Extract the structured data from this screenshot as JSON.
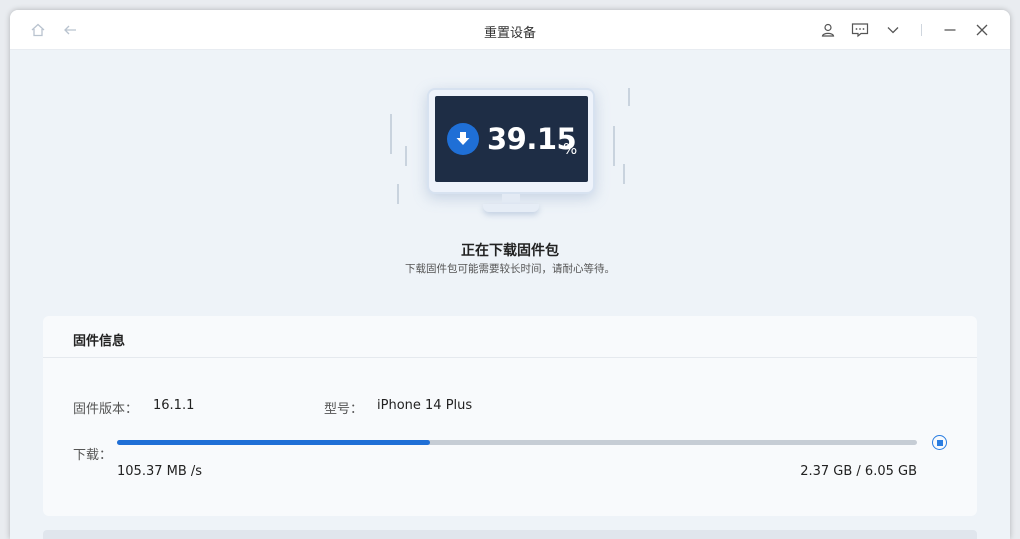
{
  "window": {
    "title": "重置设备"
  },
  "hero": {
    "progress_percent": 39.15,
    "progress_value": "39.15",
    "progress_unit": "%",
    "title": "正在下载固件包",
    "subtitle": "下载固件包可能需要较长时间，请耐心等待。"
  },
  "firmware": {
    "section_title": "固件信息",
    "version_label": "固件版本：",
    "version_value": "16.1.1",
    "model_label": "型号：",
    "model_value": "iPhone 14 Plus",
    "download_label": "下载：",
    "download_progress": 0.3915,
    "speed": "105.37 MB /s",
    "size": "2.37 GB / 6.05 GB"
  },
  "colors": {
    "accent": "#1f6fd6",
    "screen": "#1e2d45",
    "track": "#c6cdd5"
  },
  "icons": [
    "home-icon",
    "back-icon",
    "user-icon",
    "feedback-icon",
    "chevron-down-icon",
    "minimize-icon",
    "close-icon",
    "download-arrow-icon",
    "stop-icon"
  ]
}
